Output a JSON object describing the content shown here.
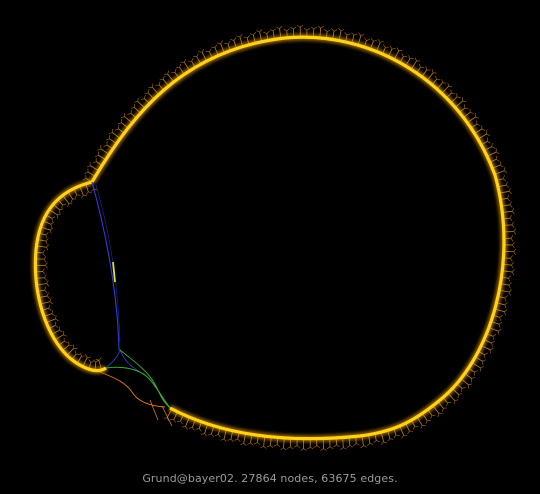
{
  "caption": "Grund@bayer02. 27864 nodes, 63675 edges.",
  "colors": {
    "background": "#000000",
    "ring_core": "#ffd21a",
    "ring_glow": "#ffae00",
    "spike": "#d98a0c",
    "link_blue": "#2b3fd8",
    "link_green": "#3fae2f",
    "link_yellow": "#e8e01c",
    "link_orange": "#e07a10",
    "caption_text": "#9a9a9a"
  }
}
